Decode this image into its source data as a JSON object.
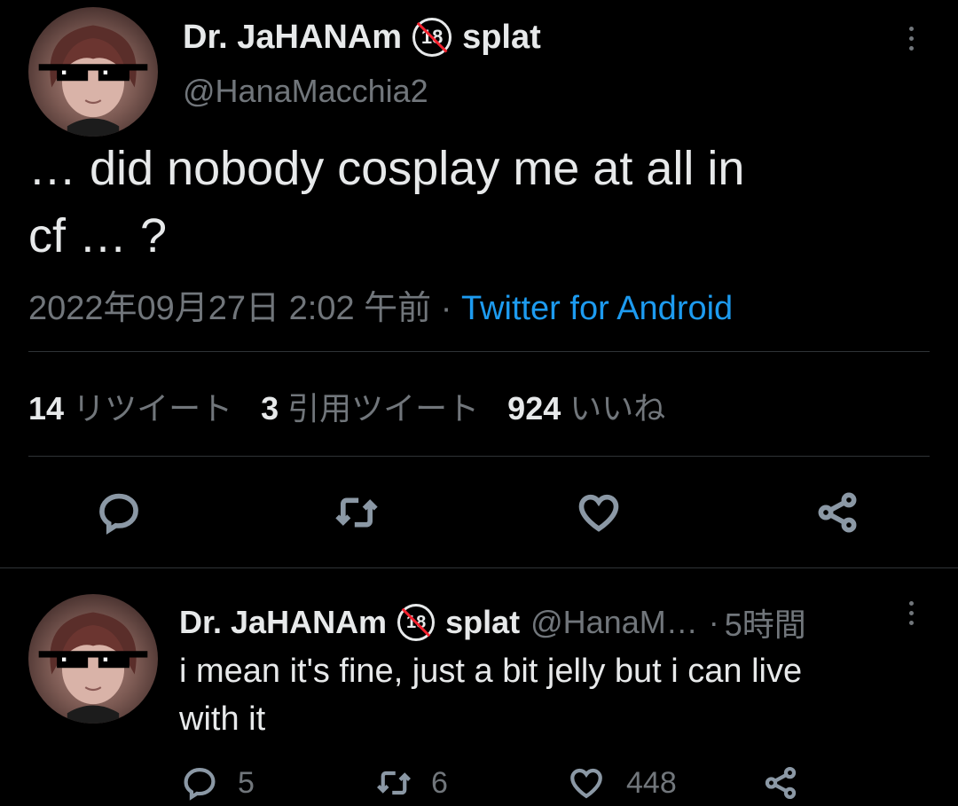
{
  "tweet": {
    "author_name": "Dr. JaHANAm",
    "badge": "18",
    "author_suffix": "splat",
    "handle": "@HanaMacchia2",
    "text_line1": "… did nobody cosplay me at all in",
    "text_line2": "cf … ?",
    "timestamp": "2022年09月27日 2:02 午前",
    "separator": "·",
    "source": "Twitter for Android",
    "stats": {
      "retweets_count": "14",
      "retweets_label": "リツイート",
      "quotes_count": "3",
      "quotes_label": "引用ツイート",
      "likes_count": "924",
      "likes_label": "いいね"
    },
    "icons": [
      "reply-icon",
      "retweet-icon",
      "like-icon",
      "share-icon",
      "more-icon"
    ]
  },
  "reply": {
    "author_name": "Dr. JaHANAm",
    "badge": "18",
    "author_suffix": "splat",
    "handle": "@HanaM…",
    "separator": "·",
    "time": "5時間",
    "text_line1": "i mean it's fine, just a bit jelly but i can live",
    "text_line2": "with it",
    "reply_count": "5",
    "retweet_count": "6",
    "like_count": "448"
  },
  "colors": {
    "background": "#000000",
    "text": "#e7e9ea",
    "secondary": "#71767b",
    "link": "#1d9bf0",
    "divider": "#2f3336",
    "badge_slash": "#f4212e"
  }
}
